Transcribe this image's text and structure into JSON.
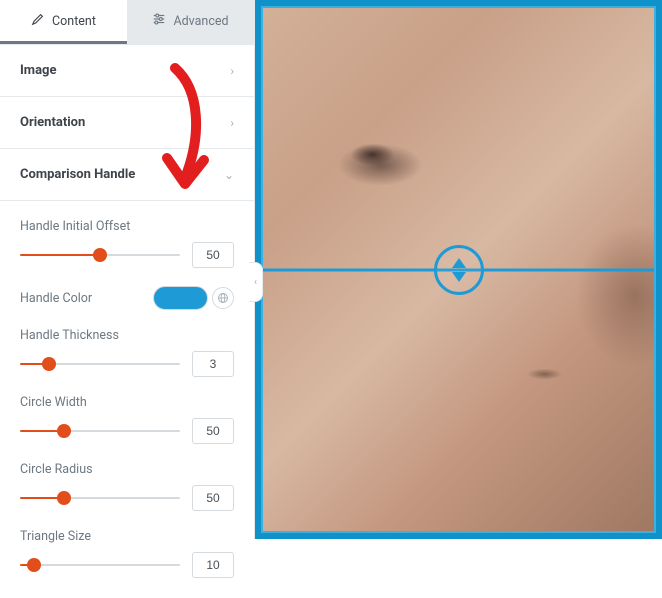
{
  "tabs": {
    "content": "Content",
    "advanced": "Advanced"
  },
  "sections": {
    "image": "Image",
    "orientation": "Orientation",
    "comparisonHandle": "Comparison Handle"
  },
  "controls": {
    "handleInitialOffset": {
      "label": "Handle Initial Offset",
      "value": "50"
    },
    "handleColor": {
      "label": "Handle Color",
      "value": "#1e9bd6"
    },
    "handleThickness": {
      "label": "Handle Thickness",
      "value": "3"
    },
    "circleWidth": {
      "label": "Circle Width",
      "value": "50"
    },
    "circleRadius": {
      "label": "Circle Radius",
      "value": "50"
    },
    "triangleSize": {
      "label": "Triangle Size",
      "value": "10"
    }
  },
  "accent": "#e24e1b"
}
